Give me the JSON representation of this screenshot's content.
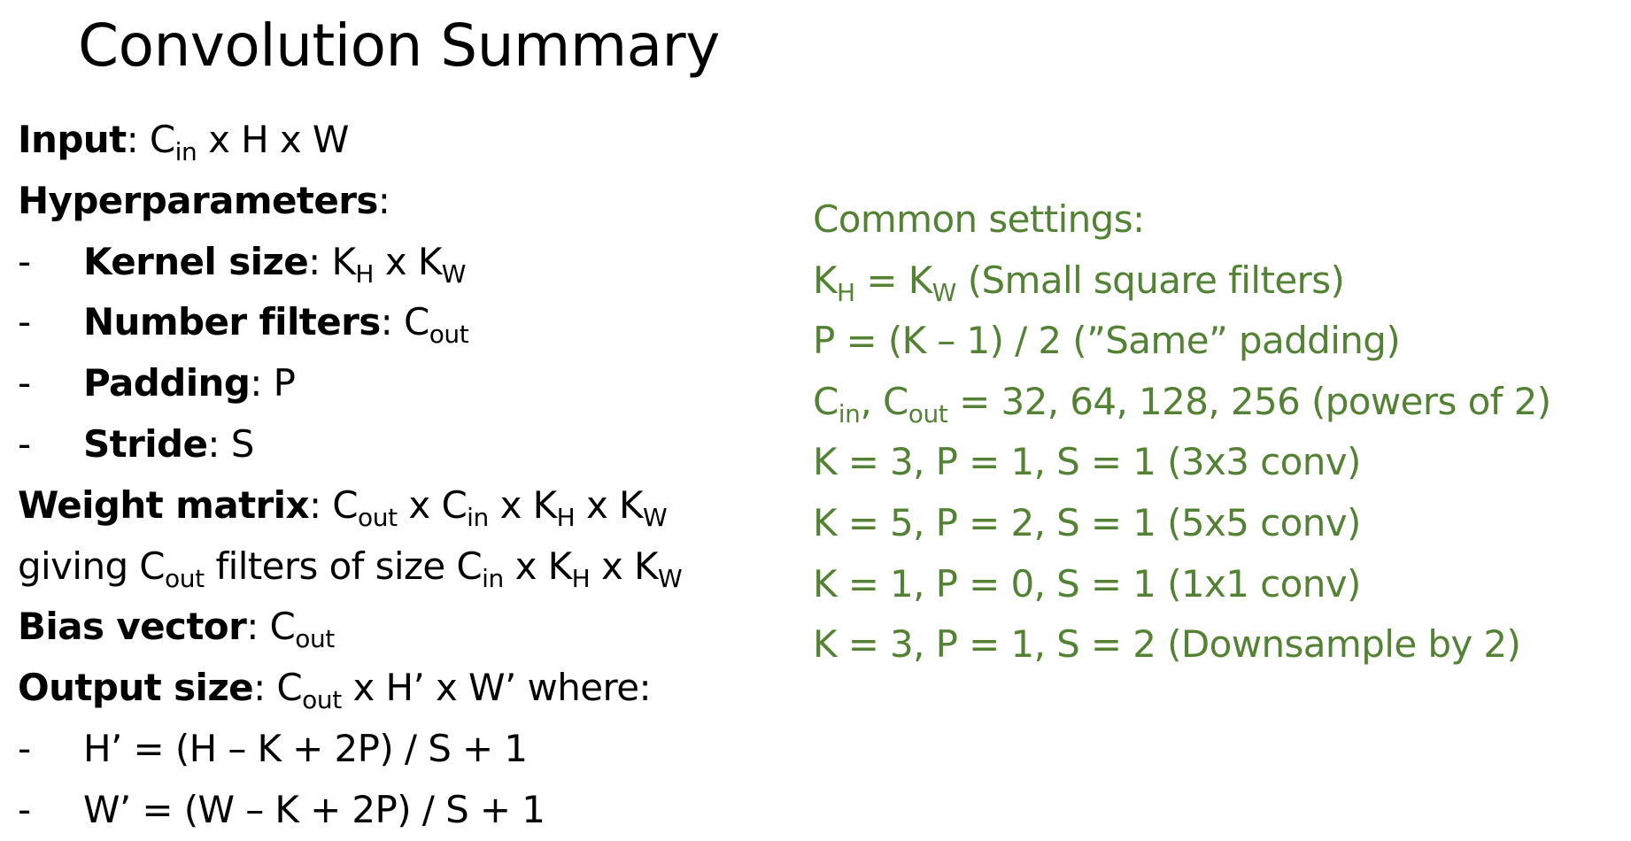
{
  "title": "Convolution Summary",
  "left": {
    "input": {
      "label": "Input",
      "sep": ": ",
      "c": "C",
      "c_sub": "in",
      "rest": " x H x W"
    },
    "hyper": {
      "label": "Hyperparameters",
      "sep": ":"
    },
    "kernel": {
      "dash": "-",
      "label": "Kernel size",
      "sep": ": ",
      "k1": "K",
      "k1_sub": "H",
      "mid": " x ",
      "k2": "K",
      "k2_sub": "W"
    },
    "filters": {
      "dash": "-",
      "label": "Number filters",
      "sep": ": ",
      "c": "C",
      "c_sub": "out"
    },
    "padding": {
      "dash": "-",
      "label": "Padding",
      "sep": ": ",
      "val": "P"
    },
    "stride": {
      "dash": "-",
      "label": "Stride",
      "sep": ": ",
      "val": "S"
    },
    "weight": {
      "label": "Weight matrix",
      "sep": ": ",
      "c1": "C",
      "c1_sub": "out",
      "x1": " x ",
      "c2": "C",
      "c2_sub": "in",
      "x2": " x ",
      "k1": "K",
      "k1_sub": "H",
      "x3": " x ",
      "k2": "K",
      "k2_sub": "W"
    },
    "giving": {
      "pre": "giving ",
      "c1": "C",
      "c1_sub": "out",
      "mid": " filters of size ",
      "c2": "C",
      "c2_sub": "in",
      "x1": " x ",
      "k1": "K",
      "k1_sub": "H",
      "x2": " x ",
      "k2": "K",
      "k2_sub": "W"
    },
    "bias": {
      "label": "Bias vector",
      "sep": ": ",
      "c": "C",
      "c_sub": "out"
    },
    "output": {
      "label": "Output size",
      "sep": ": ",
      "c": "C",
      "c_sub": "out",
      "rest": " x H’ x W’ where:"
    },
    "h_formula": {
      "dash": "-",
      "text": "H’ = (H – K + 2P) / S + 1"
    },
    "w_formula": {
      "dash": "-",
      "text": "W’ = (W – K + 2P) / S + 1"
    }
  },
  "right": {
    "heading": "Common settings:",
    "square": {
      "k1": "K",
      "k1_sub": "H",
      "mid": " = ",
      "k2": "K",
      "k2_sub": "W",
      "rest": "  (Small square filters)"
    },
    "same_pad": "P = (K – 1) / 2  (”Same” padding)",
    "channels": {
      "c1": "C",
      "c1_sub": "in",
      "comma": ", ",
      "c2": "C",
      "c2_sub": "out",
      "rest": " = 32, 64, 128, 256 (powers of 2)"
    },
    "conv3": "K = 3, P = 1, S = 1 (3x3 conv)",
    "conv5": "K = 5, P = 2, S = 1 (5x5 conv)",
    "conv1": "K = 1, P = 0, S = 1 (1x1 conv)",
    "down": "K = 3, P = 1, S = 2 (Downsample by 2)"
  },
  "colors": {
    "text": "#000000",
    "accent": "#548235",
    "background": "#ffffff"
  }
}
